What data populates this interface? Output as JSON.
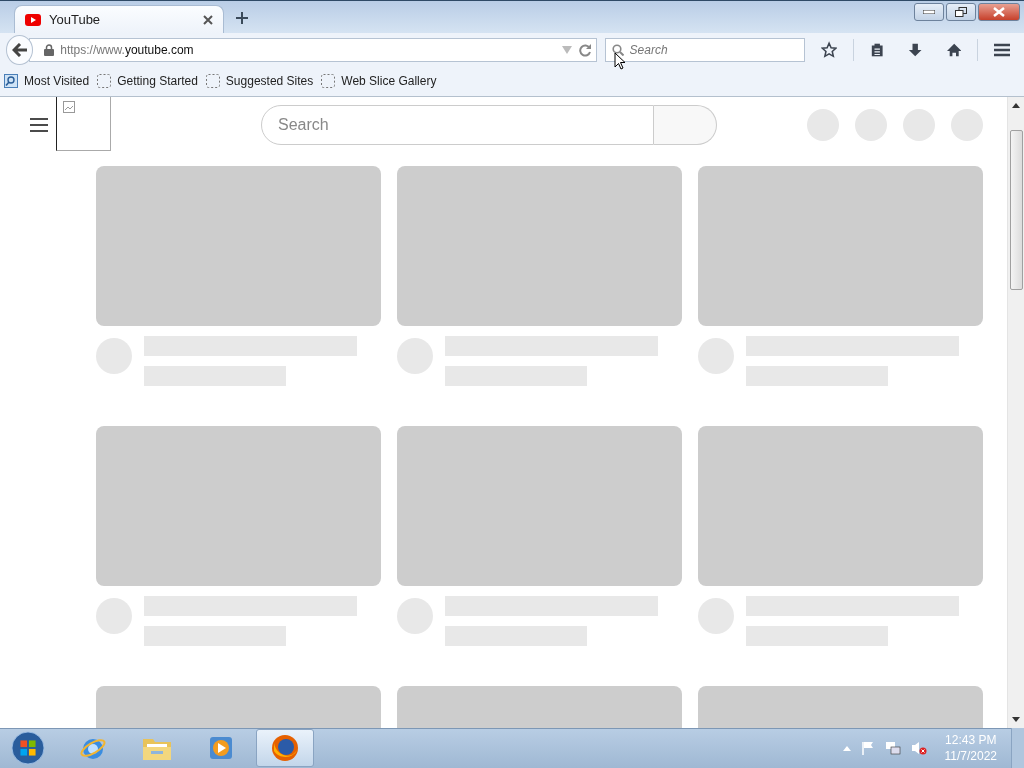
{
  "tabs": [
    {
      "title": "YouTube",
      "selected": true
    }
  ],
  "address_bar": {
    "prefix": "https://www.",
    "domain": "youtube.com"
  },
  "browser_search": {
    "placeholder": "Search"
  },
  "bookmarks": [
    {
      "label": "Most Visited",
      "kind": "smart"
    },
    {
      "label": "Getting Started",
      "kind": "page"
    },
    {
      "label": "Suggested Sites",
      "kind": "page"
    },
    {
      "label": "Web Slice Gallery",
      "kind": "page"
    }
  ],
  "page": {
    "search": {
      "placeholder": "Search"
    }
  },
  "taskbar": {
    "apps": [
      {
        "kind": "ie",
        "selected": false
      },
      {
        "kind": "explorer",
        "selected": false
      },
      {
        "kind": "media",
        "selected": false
      },
      {
        "kind": "firefox",
        "selected": true
      }
    ],
    "time": "12:43 PM",
    "date": "11/7/2022"
  }
}
